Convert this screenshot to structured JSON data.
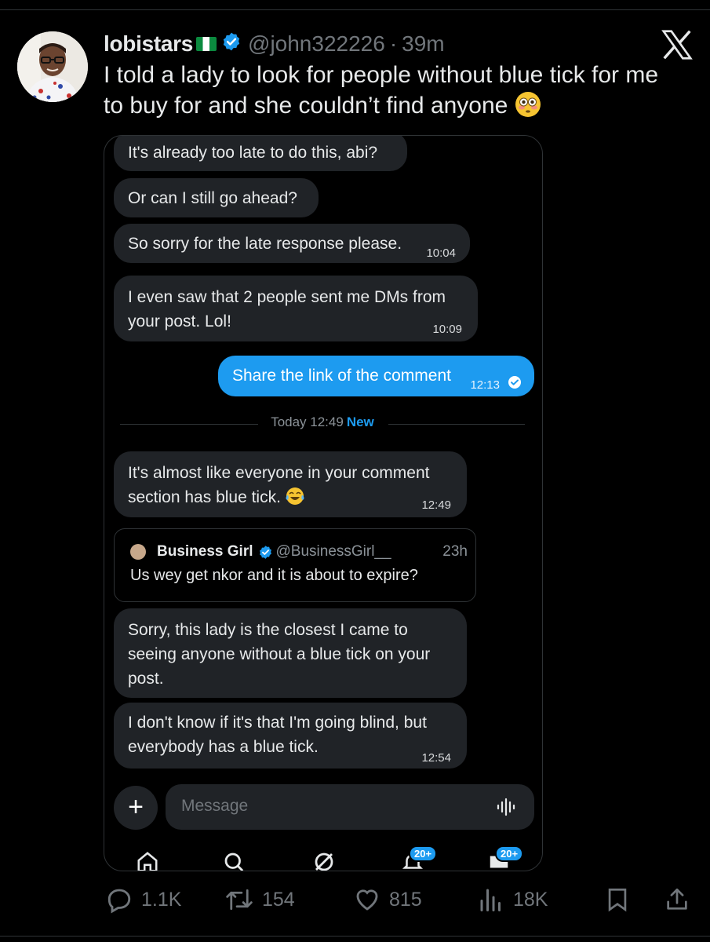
{
  "tweet": {
    "display_name": "lobistars",
    "handle": "@john322226",
    "separator": "·",
    "time": "39m",
    "text": "I told a lady to look for people without blue tick for me to buy for and she couldn’t find anyone"
  },
  "chat": {
    "messages": [
      {
        "text": "It's already too late to do this, abi?",
        "time": ""
      },
      {
        "text": "Or can I still go ahead?",
        "time": ""
      },
      {
        "text": "So sorry for the late response please.",
        "time": "10:04"
      },
      {
        "text": "I even saw that 2 people sent me DMs from your post. Lol!",
        "time": "10:09"
      },
      {
        "text": "Share the link of the comment",
        "time": "12:13"
      },
      {
        "text": "It's almost like everyone in your comment section has blue tick.",
        "time": "12:49"
      },
      {
        "text": "Sorry, this lady is the closest I came to seeing anyone without a blue tick on your post.",
        "time": ""
      },
      {
        "text": "I don't know if it's that I'm going blind, but everybody has a blue tick.",
        "time": "12:54"
      }
    ],
    "separator": {
      "label": "Today 12:49",
      "new_label": "New"
    },
    "quoted_post": {
      "name": "Business Girl",
      "handle": "@BusinessGirl__",
      "time": "23h",
      "text": "Us wey get nkor and it is about to expire?"
    },
    "composer": {
      "placeholder": "Message",
      "add_label": "+"
    },
    "nav_badges": {
      "notifications": "20+",
      "messages": "20+"
    }
  },
  "actions": {
    "replies": "1.1K",
    "reposts": "154",
    "likes": "815",
    "views": "18K"
  },
  "colors": {
    "accent": "#1d9bf0",
    "bubble": "#202327",
    "background": "#000000"
  }
}
